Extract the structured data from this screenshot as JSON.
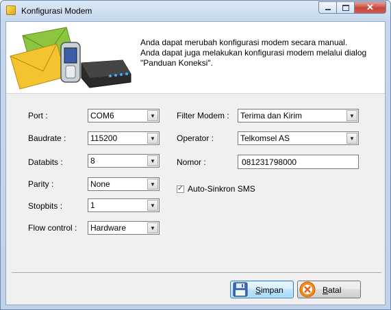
{
  "window": {
    "title": "Konfigurasi Modem"
  },
  "banner": {
    "lines": [
      "Anda dapat merubah konfigurasi modem secara manual.",
      "Anda dapat juga melakukan konfigurasi modem melalui dialog",
      "\"Panduan Koneksi\"."
    ]
  },
  "form": {
    "port": {
      "label": "Port :",
      "value": "COM6"
    },
    "baudrate": {
      "label": "Baudrate :",
      "value": "115200"
    },
    "databits": {
      "label": "Databits :",
      "value": "8"
    },
    "parity": {
      "label": "Parity :",
      "value": "None"
    },
    "stopbits": {
      "label": "Stopbits :",
      "value": "1"
    },
    "flow_control": {
      "label": "Flow control :",
      "value": "Hardware"
    },
    "filter_modem": {
      "label": "Filter Modem :",
      "value": "Terima dan Kirim"
    },
    "operator": {
      "label": "Operator :",
      "value": "Telkomsel AS"
    },
    "nomor": {
      "label": "Nomor :",
      "value": "081231798000"
    },
    "auto_sync": {
      "label": "Auto-Sinkron SMS",
      "checked": true
    }
  },
  "buttons": {
    "save_first": "S",
    "save_rest": "impan",
    "cancel_first": "B",
    "cancel_rest": "atal"
  },
  "icons": {
    "window": "app-icon",
    "minimize": "minimize-icon",
    "maximize": "maximize-icon",
    "close": "close-icon",
    "dropdown": "chevron-down-icon",
    "save": "floppy-disk-icon",
    "cancel": "cancel-x-icon",
    "banner": "envelopes-phone-modem-icon"
  }
}
